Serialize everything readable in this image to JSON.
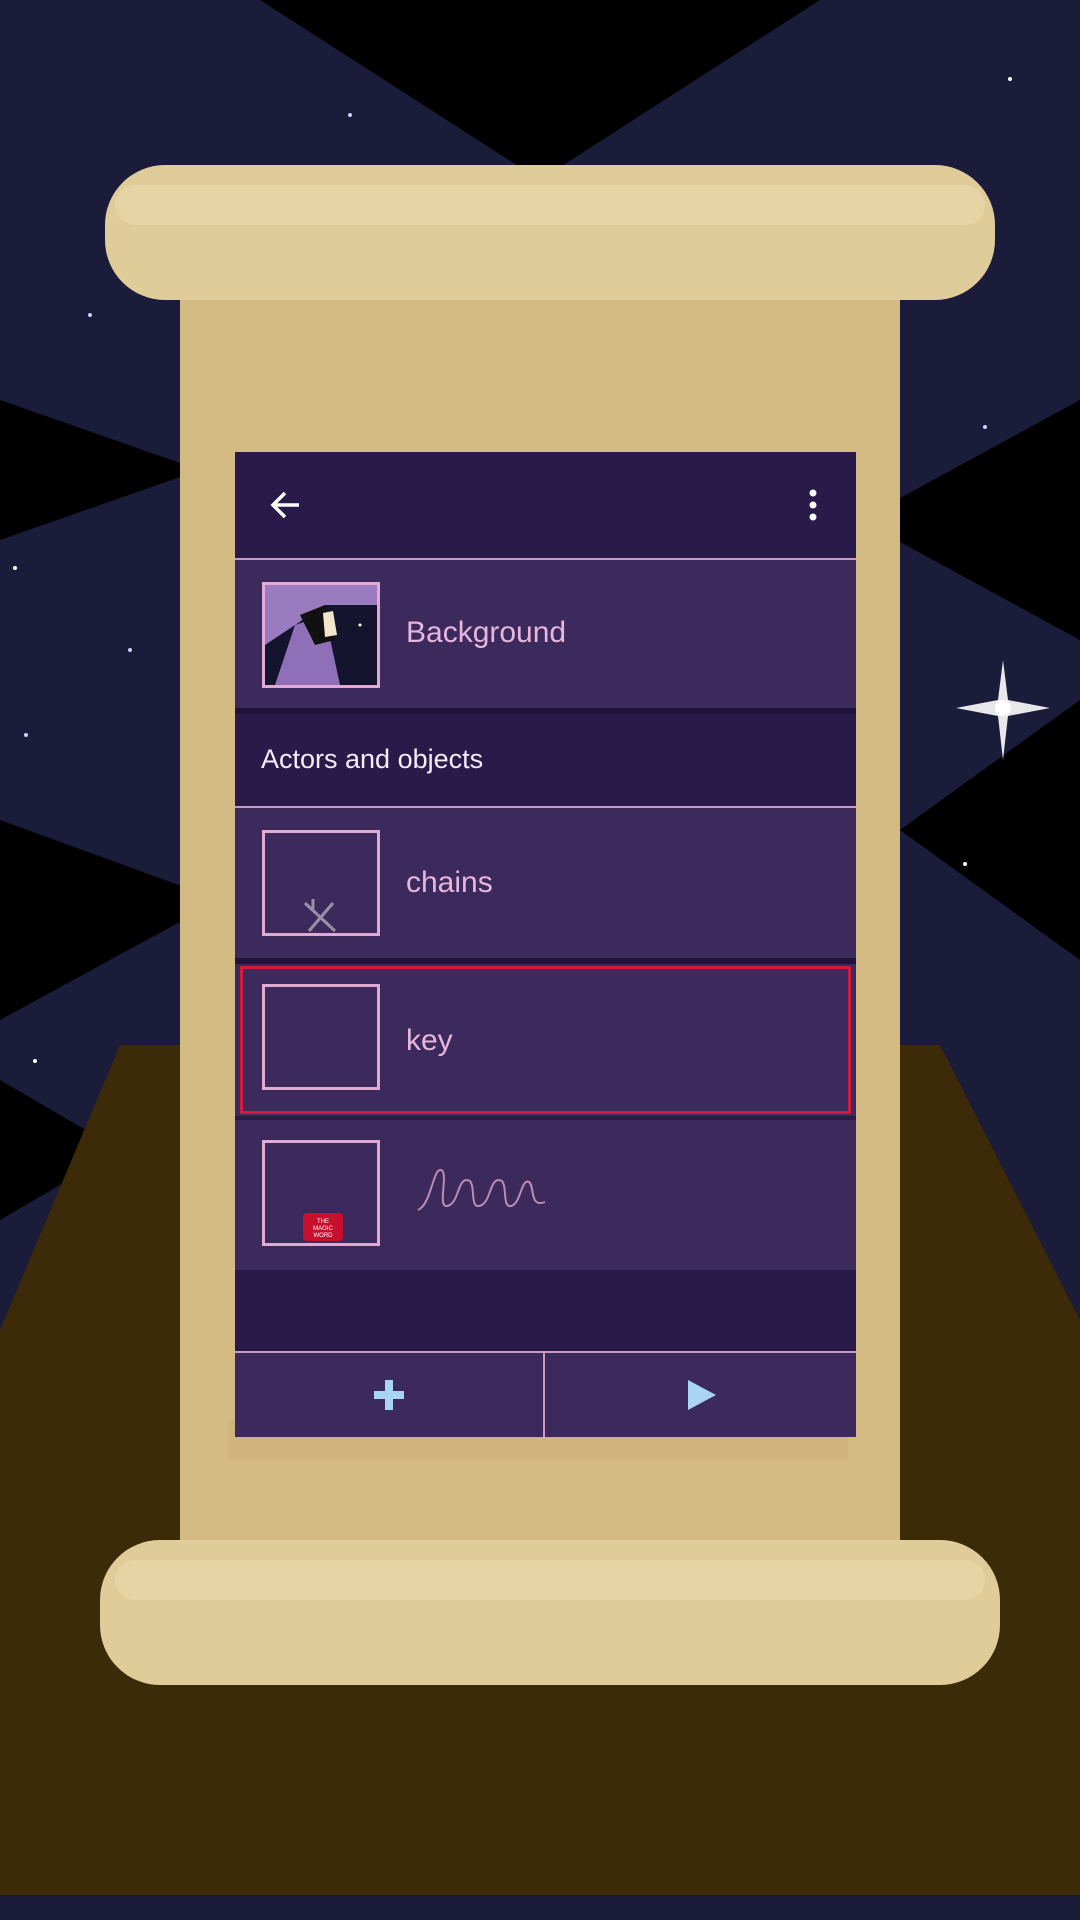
{
  "toolbar": {
    "back_icon": "arrow-left-icon",
    "menu_icon": "more-vertical-icon"
  },
  "background_item": {
    "label": "Background"
  },
  "section": {
    "title": "Actors and objects"
  },
  "items": [
    {
      "label": "chains"
    },
    {
      "label": "key"
    },
    {
      "label": ""
    }
  ],
  "bottom_bar": {
    "add_icon": "plus-icon",
    "play_icon": "play-icon"
  },
  "magic_word_thumb_text": "THE MAGIC WORD",
  "colors": {
    "panel_dark": "#2a1a4a",
    "row": "#3c2a5c",
    "accent_pink": "#e2aad3",
    "icon_blue": "#a9d4f2",
    "highlight_red": "#d21a3a",
    "parchment": "#d8c08a",
    "floor": "#3c2a08"
  }
}
